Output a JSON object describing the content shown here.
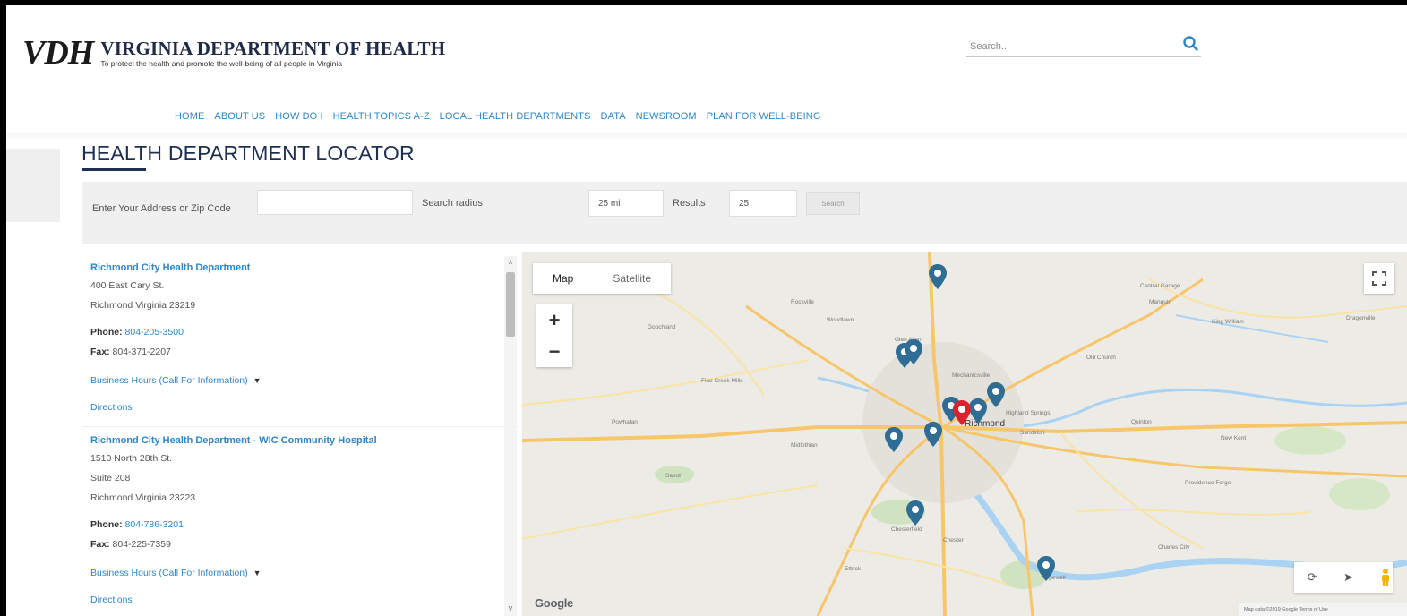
{
  "header": {
    "logo_mark": "VDH",
    "org_name": "VIRGINIA DEPARTMENT OF HEALTH",
    "tagline": "To protect the health and promote the well-being of all people in Virginia",
    "search_placeholder": "Search..."
  },
  "nav": {
    "items": [
      "HOME",
      "ABOUT US",
      "HOW DO I",
      "HEALTH TOPICS A-Z",
      "LOCAL HEALTH DEPARTMENTS",
      "DATA",
      "NEWSROOM",
      "PLAN FOR WELL-BEING"
    ]
  },
  "page": {
    "title": "HEALTH DEPARTMENT LOCATOR"
  },
  "form": {
    "address_label": "Enter Your Address or Zip Code",
    "address_value": "",
    "radius_label": "Search radius",
    "radius_value": "25 mi",
    "results_label": "Results",
    "results_value": "25",
    "search_button": "Search"
  },
  "results": [
    {
      "name": "Richmond City Health Department",
      "address_lines": [
        "400 East Cary St.",
        "Richmond Virginia 23219"
      ],
      "phone_label": "Phone:",
      "phone": "804-205-3500",
      "fax_label": "Fax:",
      "fax": "804-371-2207",
      "hours": "Business Hours (Call For Information)",
      "directions": "Directions"
    },
    {
      "name": "Richmond City Health Department - WIC Community Hospital",
      "address_lines": [
        "1510 North 28th St.",
        "Suite 208",
        "Richmond Virginia 23223"
      ],
      "phone_label": "Phone:",
      "phone": "804-786-3201",
      "fax_label": "Fax:",
      "fax": "804-225-7359",
      "hours": "Business Hours (Call For Information)",
      "directions": "Directions"
    }
  ],
  "map": {
    "map_button": "Map",
    "satellite_button": "Satellite",
    "zoom_in": "+",
    "zoom_out": "−",
    "google_label": "Google",
    "attribution": "Map data ©2019 Google   Terms of Use",
    "labels": {
      "central_garage": "Central Garage",
      "manquin": "Manquin",
      "king_william": "King William",
      "dragonville": "Dragonville",
      "old_church": "Old Church",
      "highland_springs": "Highland Springs",
      "sandston": "Sandston",
      "quinton": "Quinton",
      "new_kent": "New Kent",
      "providence_forge": "Providence Forge",
      "chesterfield": "Chesterfield",
      "hopewell": "Hopewell",
      "charles_city": "Charles City",
      "midlothian": "Midlothian",
      "powhatan": "Powhatan",
      "rockville": "Rockville",
      "woodlawn": "Woodlawn",
      "mechanicsville": "Mechanicsville",
      "glen_allen": "Glen Allen",
      "richmond": "Richmond",
      "chester": "Chester",
      "ettrick": "Ettrick",
      "fine_creek_mills": "Fine Creek Mills",
      "goochland": "Goochland",
      "sabot": "Sabot"
    },
    "accent": "#2f6d94",
    "selected_pin": "#d9232e"
  },
  "colors": {
    "link": "#2e86c7",
    "title": "#1f2f4f"
  }
}
